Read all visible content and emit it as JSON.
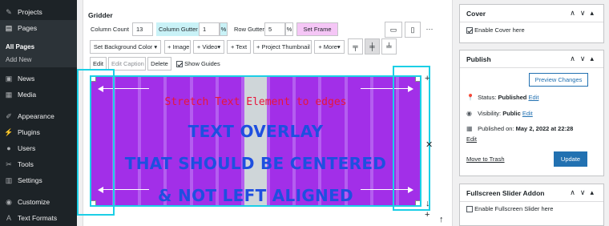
{
  "sidebar": {
    "items": [
      {
        "label": "Projects",
        "icon": "pin-icon"
      },
      {
        "label": "Pages",
        "icon": "pages-icon",
        "current": true
      },
      {
        "label": "News",
        "icon": "news-icon"
      },
      {
        "label": "Media",
        "icon": "media-icon"
      },
      {
        "label": "Appearance",
        "icon": "appearance-icon"
      },
      {
        "label": "Plugins",
        "icon": "plugins-icon"
      },
      {
        "label": "Users",
        "icon": "users-icon"
      },
      {
        "label": "Tools",
        "icon": "tools-icon"
      },
      {
        "label": "Settings",
        "icon": "settings-icon"
      },
      {
        "label": "Customize",
        "icon": "customize-icon"
      },
      {
        "label": "Text Formats",
        "icon": "text-formats-icon"
      }
    ],
    "submenu": [
      "All Pages",
      "Add New"
    ]
  },
  "gridder": {
    "title": "Gridder",
    "column_count_label": "Column Count",
    "column_count_value": "13",
    "column_gutter_label": "Column Gutter",
    "column_gutter_value": "1",
    "column_gutter_unit": "%",
    "row_gutter_label": "Row Gutter",
    "row_gutter_value": "5",
    "row_gutter_unit": "%",
    "set_frame_label": "Set Frame",
    "more_dots": "···",
    "set_background_color_label": "Set Background Color",
    "image_label": "+ Image",
    "video_label": "+ Video",
    "text_label": "+ Text",
    "project_thumbnail_label": "+ Project Thumbnail",
    "more_label": "+ More",
    "edit_label": "Edit",
    "edit_caption_label": "Edit Caption",
    "delete_label": "Delete",
    "show_guides_label": "Show Guides"
  },
  "stage": {
    "stretch_text": "Stretch Text Element to edges",
    "overlay_lines": [
      "TEXT OVERLAY",
      "THAT SHOULD BE CENTERED",
      "& NOT LEFT ALIGNED"
    ],
    "background_color": "#a22fe8",
    "text_color": "#1e4fe0",
    "stretch_color": "#e8163b",
    "frame_color": "#1ccfe6"
  },
  "cover": {
    "title": "Cover",
    "checkbox_label": "Enable Cover here",
    "checked": true
  },
  "publish": {
    "title": "Publish",
    "preview_label": "Preview Changes",
    "status_label": "Status:",
    "status_value": "Published",
    "status_edit": "Edit",
    "visibility_label": "Visibility:",
    "visibility_value": "Public",
    "visibility_edit": "Edit",
    "published_on_label": "Published on:",
    "published_on_value": "May 2, 2022 at 22:28",
    "published_edit": "Edit",
    "trash_label": "Move to Trash",
    "update_label": "Update",
    "update_color": "#2271b1"
  },
  "slider_addon": {
    "title": "Fullscreen Slider Addon",
    "checkbox_label": "Enable Fullscreen Slider here",
    "checked": false
  }
}
